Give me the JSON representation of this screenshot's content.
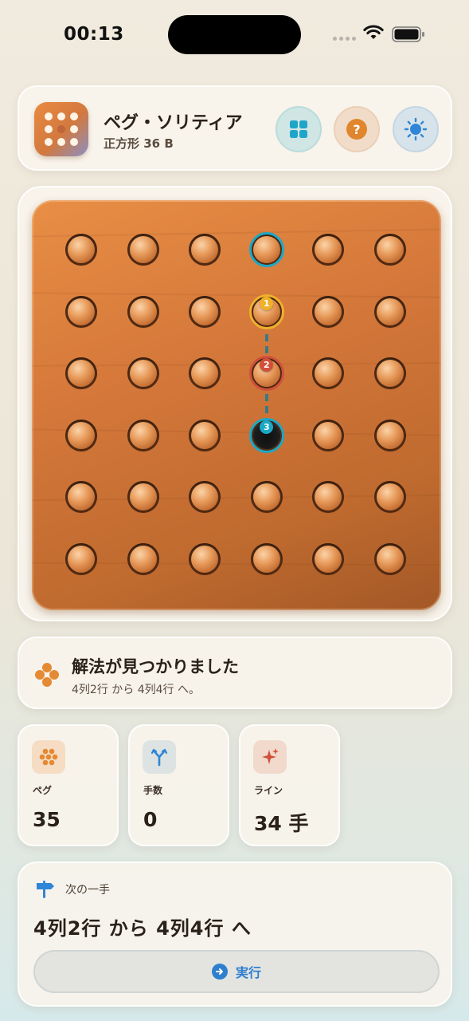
{
  "status_bar": {
    "time": "00:13"
  },
  "header": {
    "title": "ペグ・ソリティア",
    "subtitle": "正方形 36 B",
    "buttons": [
      {
        "name": "grid-icon",
        "color": "#1fa5c8"
      },
      {
        "name": "help-icon",
        "label": "?",
        "color": "#e0862e"
      },
      {
        "name": "sun-icon",
        "color": "#2f86d6"
      }
    ]
  },
  "board": {
    "rows": 6,
    "cols": 6,
    "empty": [
      [
        4,
        4
      ]
    ],
    "rings": [
      {
        "col": 4,
        "row": 1,
        "color": "#1ba8c6"
      },
      {
        "col": 4,
        "row": 2,
        "color": "#f0b12a",
        "badge": "1"
      },
      {
        "col": 4,
        "row": 3,
        "color": "#d0503a",
        "badge": "2"
      },
      {
        "col": 4,
        "row": 4,
        "color": "#1ba8c6",
        "badge": "3"
      }
    ]
  },
  "message": {
    "title": "解法が見つかりました",
    "detail": "4列2行 から 4列4行 へ。"
  },
  "stats": [
    {
      "label": "ペグ",
      "value": "35",
      "icon": "pegs-icon",
      "tint": "#f5dcc2",
      "color": "#e48a35"
    },
    {
      "label": "手数",
      "value": "0",
      "icon": "branch-icon",
      "tint": "#dde3e2",
      "color": "#2f86d6"
    },
    {
      "label": "ライン",
      "value": "34 手",
      "icon": "sparkle-icon",
      "tint": "#f1d9cc",
      "color": "#d0503a"
    }
  ],
  "next_move": {
    "label": "次の一手",
    "move": "4列2行 から 4列4行 へ",
    "button_label": "実行"
  }
}
